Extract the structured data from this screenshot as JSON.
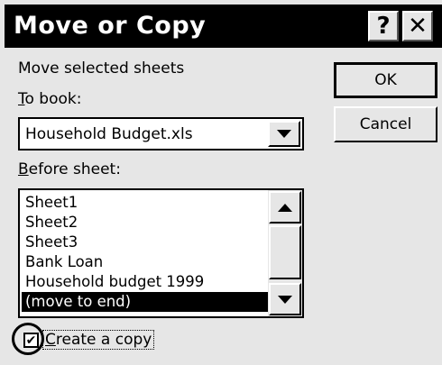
{
  "window": {
    "title": "Move or Copy",
    "help_glyph": "?",
    "close_glyph": "✕"
  },
  "labels": {
    "move_selected": "Move selected sheets",
    "to_book_mnemonic": "T",
    "to_book_rest": "o book:",
    "before_sheet_mnemonic": "B",
    "before_sheet_rest": "efore sheet:"
  },
  "to_book": {
    "value": "Household Budget.xls"
  },
  "before_sheet": {
    "items": [
      "Sheet1",
      "Sheet2",
      "Sheet3",
      "Bank Loan",
      "Household budget 1999",
      "(move to end)"
    ],
    "selected": "(move to end)"
  },
  "buttons": {
    "ok": "OK",
    "cancel": "Cancel"
  },
  "create_copy": {
    "checked": true,
    "check_glyph": "✔",
    "label_mnemonic": "C",
    "label_rest": "reate a copy"
  },
  "colors": {
    "title_bar": "#000000",
    "dialog_bg": "#e6e6e6",
    "selection_bg": "#000000"
  }
}
